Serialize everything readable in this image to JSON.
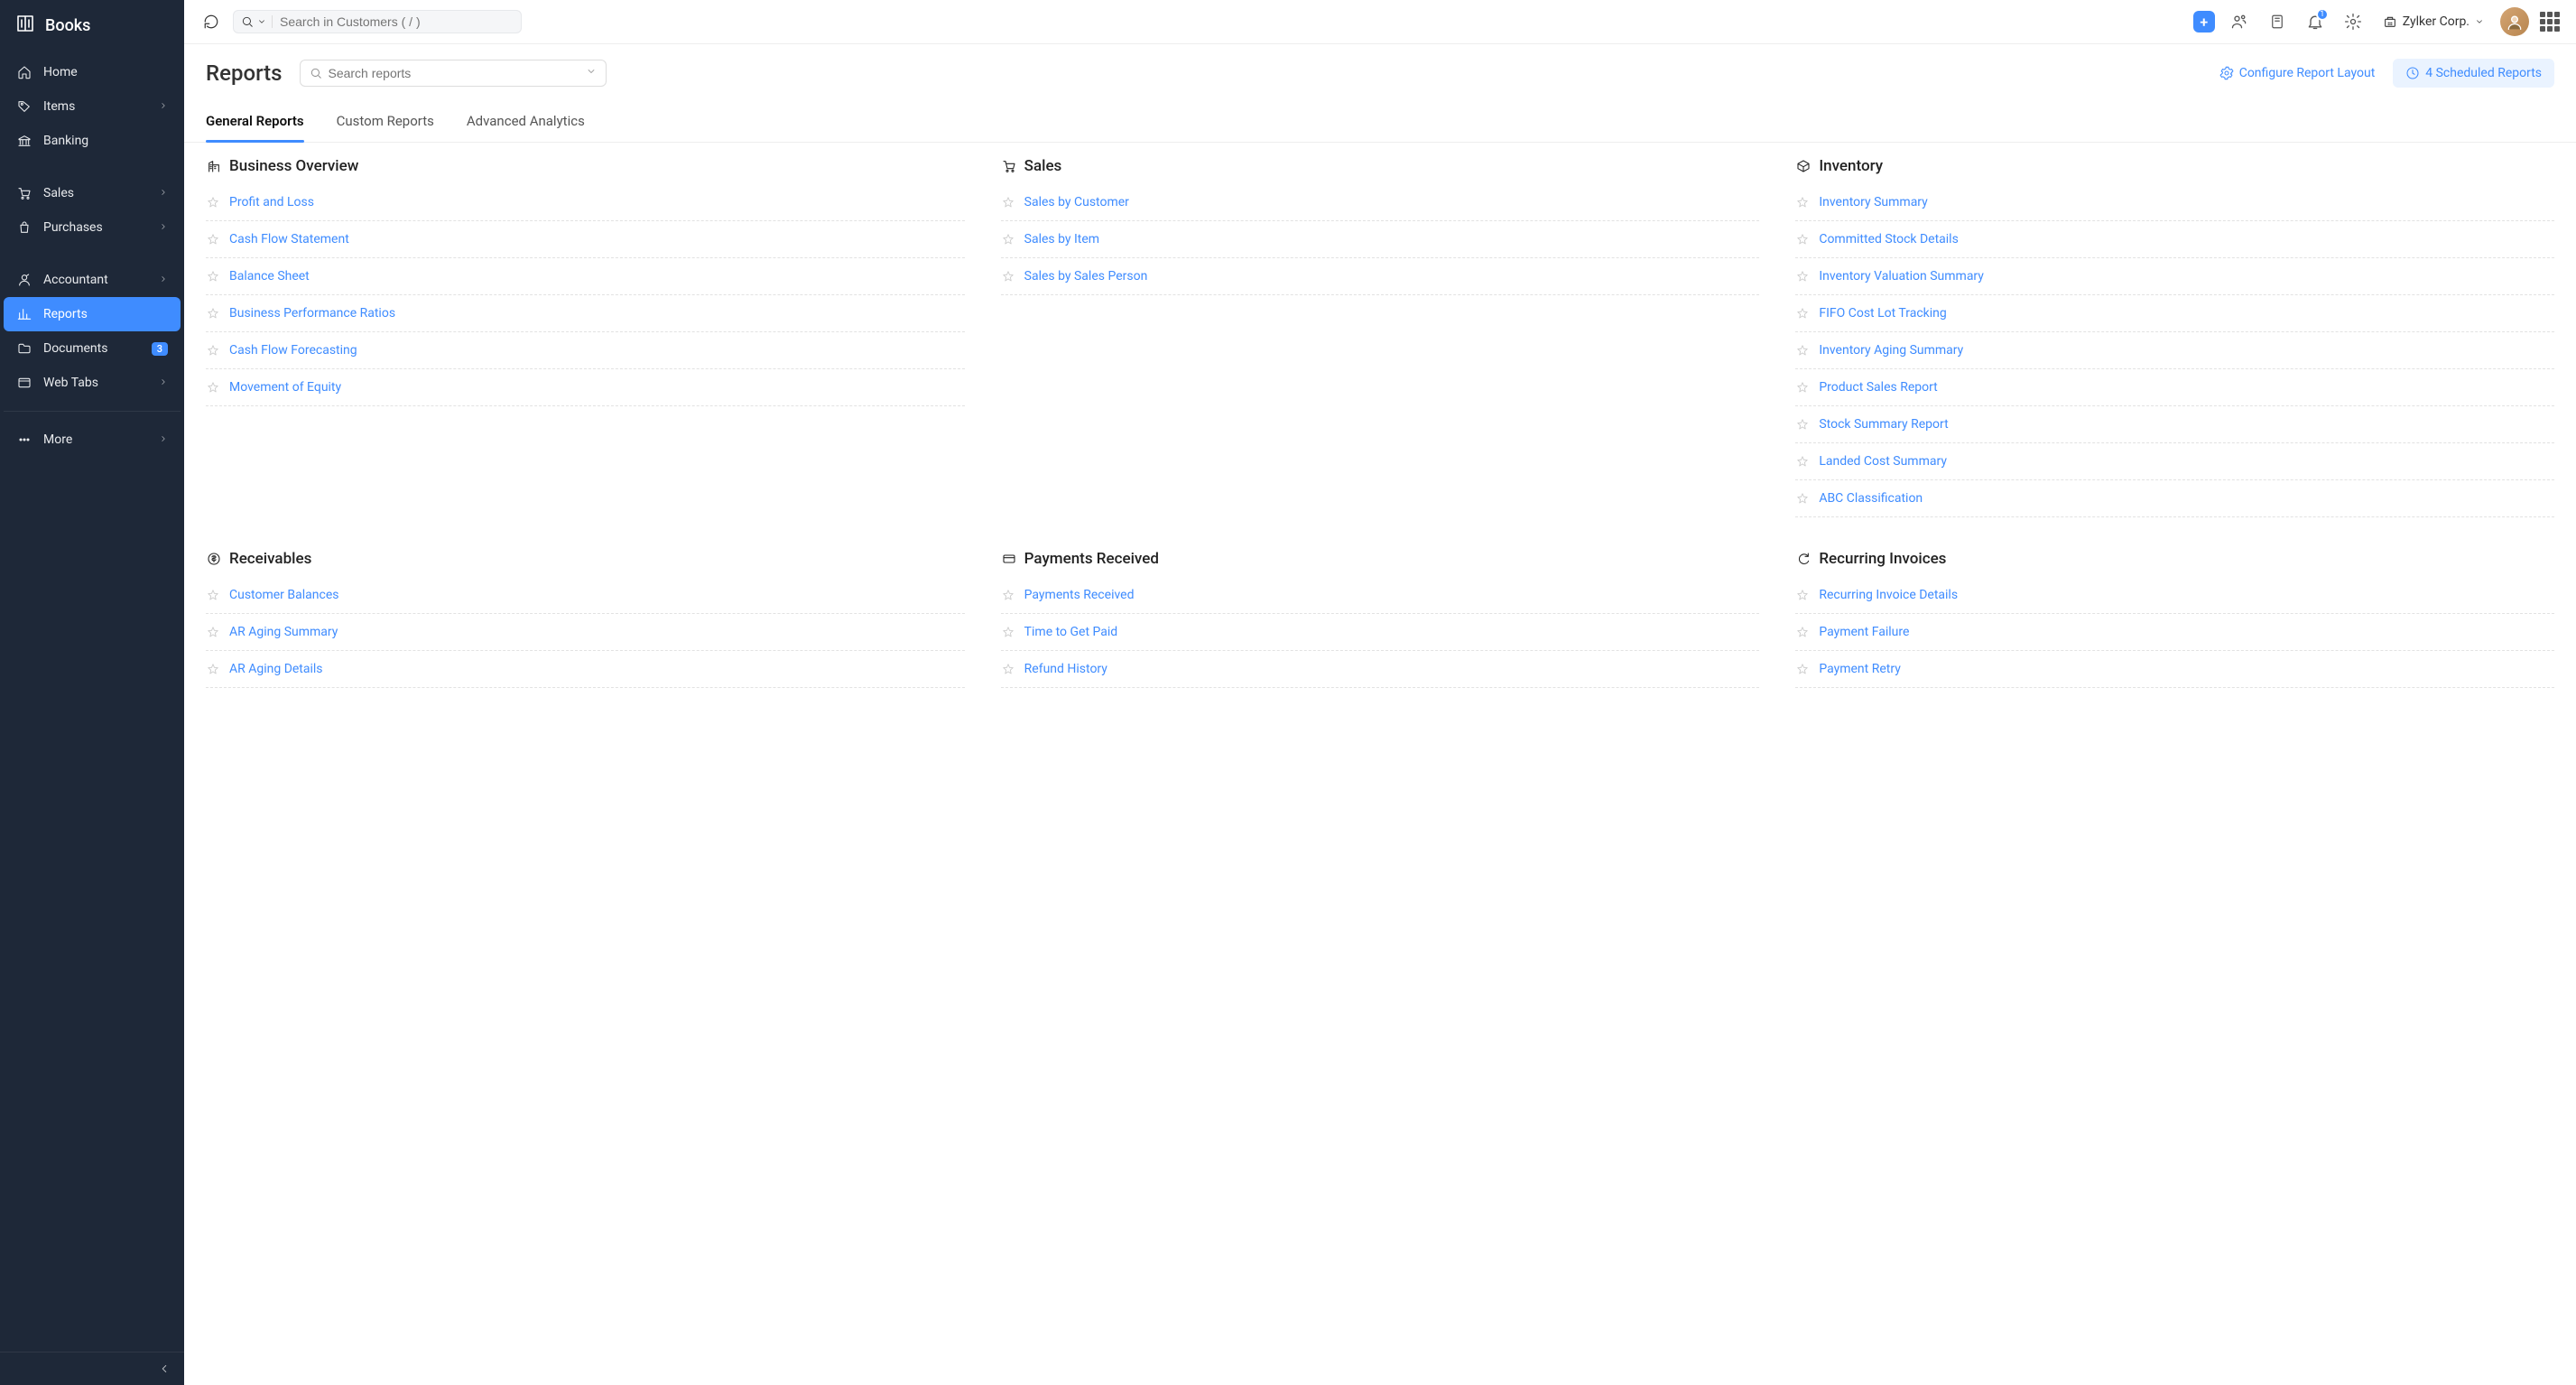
{
  "app_name": "Books",
  "topbar": {
    "search_placeholder": "Search in Customers ( / )",
    "notification_count": "1",
    "org_name": "Zylker Corp."
  },
  "sidebar": {
    "items": [
      {
        "label": "Home",
        "icon": "home-icon",
        "expandable": false
      },
      {
        "label": "Items",
        "icon": "tag-icon",
        "expandable": true
      },
      {
        "label": "Banking",
        "icon": "bank-icon",
        "expandable": false
      },
      {
        "gap": true
      },
      {
        "label": "Sales",
        "icon": "cart-icon",
        "expandable": true
      },
      {
        "label": "Purchases",
        "icon": "bag-icon",
        "expandable": true
      },
      {
        "gap": true
      },
      {
        "label": "Accountant",
        "icon": "accountant-icon",
        "expandable": true
      },
      {
        "label": "Reports",
        "icon": "chart-icon",
        "expandable": false,
        "active": true
      },
      {
        "label": "Documents",
        "icon": "folder-icon",
        "expandable": false,
        "badge": "3"
      },
      {
        "label": "Web Tabs",
        "icon": "window-icon",
        "expandable": true
      },
      {
        "divider": true
      },
      {
        "label": "More",
        "icon": "more-icon",
        "expandable": true
      }
    ]
  },
  "page": {
    "title": "Reports",
    "search_placeholder": "Search reports",
    "configure_label": "Configure Report Layout",
    "scheduled_label": "4 Scheduled Reports"
  },
  "tabs": [
    {
      "label": "General Reports",
      "active": true
    },
    {
      "label": "Custom Reports"
    },
    {
      "label": "Advanced Analytics"
    }
  ],
  "sections_row1": {
    "business_overview": {
      "title": "Business Overview",
      "icon": "building-icon",
      "items": [
        "Profit and Loss",
        "Cash Flow Statement",
        "Balance Sheet",
        "Business Performance Ratios",
        "Cash Flow Forecasting",
        "Movement of Equity"
      ]
    },
    "sales": {
      "title": "Sales",
      "icon": "cart-icon",
      "items": [
        "Sales by Customer",
        "Sales by Item",
        "Sales by Sales Person"
      ]
    },
    "inventory": {
      "title": "Inventory",
      "icon": "box-icon",
      "items": [
        "Inventory Summary",
        "Committed Stock Details",
        "Inventory Valuation Summary",
        "FIFO Cost Lot Tracking",
        "Inventory Aging Summary",
        "Product Sales Report",
        "Stock Summary Report",
        "Landed Cost Summary",
        "ABC Classification"
      ]
    }
  },
  "sections_row2": {
    "receivables": {
      "title": "Receivables",
      "icon": "receivables-icon",
      "items": [
        "Customer Balances",
        "AR Aging Summary",
        "AR Aging Details"
      ]
    },
    "payments_received": {
      "title": "Payments Received",
      "icon": "card-icon",
      "items": [
        "Payments Received",
        "Time to Get Paid",
        "Refund History"
      ]
    },
    "recurring_invoices": {
      "title": "Recurring Invoices",
      "icon": "recurring-icon",
      "items": [
        "Recurring Invoice Details",
        "Payment Failure",
        "Payment Retry"
      ]
    }
  }
}
